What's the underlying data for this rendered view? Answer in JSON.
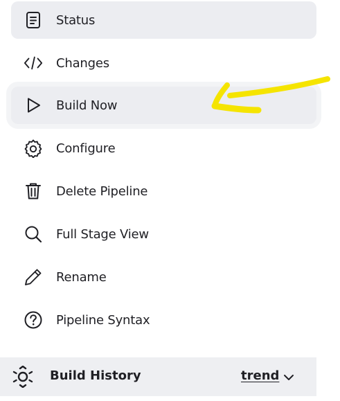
{
  "menu": {
    "items": [
      {
        "label": "Status",
        "icon": "status-document-icon",
        "state": "active"
      },
      {
        "label": "Changes",
        "icon": "code-brackets-icon"
      },
      {
        "label": "Build Now",
        "icon": "play-icon",
        "state": "hovered"
      },
      {
        "label": "Configure",
        "icon": "gear-icon"
      },
      {
        "label": "Delete Pipeline",
        "icon": "trash-icon"
      },
      {
        "label": "Full Stage View",
        "icon": "search-icon"
      },
      {
        "label": "Rename",
        "icon": "pencil-icon"
      },
      {
        "label": "Pipeline Syntax",
        "icon": "help-circle-icon"
      }
    ]
  },
  "build_history": {
    "title": "Build History",
    "trend_label": "trend",
    "icon": "build-history-icon",
    "dropdown_icon": "chevron-down-icon"
  },
  "annotation": {
    "type": "hand-drawn-arrow",
    "color": "#f5e400",
    "points_to": "Build Now"
  },
  "colors": {
    "active_bg": "#ecedf1",
    "text": "#1f1f24",
    "history_bar_bg": "#eeeff2"
  }
}
